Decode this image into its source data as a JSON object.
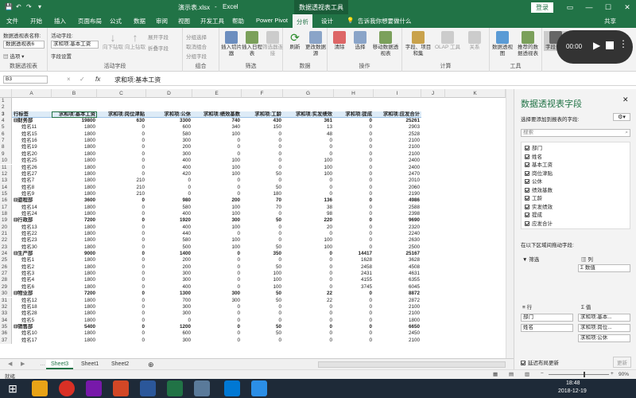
{
  "titlebar": {
    "filename": "演示表.xlsx",
    "sep": "-",
    "app": "Excel",
    "context_tab": "数据透视表工具",
    "login": "登录"
  },
  "tabs": [
    "文件",
    "开始",
    "插入",
    "页面布局",
    "公式",
    "数据",
    "审阅",
    "视图",
    "开发工具",
    "帮助",
    "Power Pivot",
    "分析",
    "设计"
  ],
  "tellme": "告诉我你想要做什么",
  "share": "共享",
  "ribbon": {
    "pivot_name_label": "数据透视表名称:",
    "pivot_name": "数据透视表6",
    "options": "选项",
    "active_field_label": "活动字段:",
    "active_field": "求和项:基本工资",
    "field_settings": "字段设置",
    "drill_down": "向下钻取",
    "drill_up": "向上钻取",
    "expand": "展开字段",
    "collapse": "折叠字段",
    "group_sel": "分组选择",
    "ungroup": "取消组合",
    "group_field": "分组字段",
    "group_label": "组合",
    "slicer": "插入切片器",
    "timeline": "插入日程表",
    "filter_conn": "筛选器连接",
    "filter_label": "筛选",
    "refresh": "刷新",
    "change_source": "更改数据源",
    "data_label": "数据",
    "clear": "清除",
    "select": "选择",
    "move": "移动数据透视表",
    "action_label": "操作",
    "fields_items": "字段、项目和集",
    "olap": "OLAP 工具",
    "relations": "关系",
    "calc_label": "计算",
    "pivotchart": "数据透视图",
    "recommended": "推荐的数据透视表",
    "tools_label": "工具",
    "field_list": "字段列表",
    "active_field_group": "活动字段",
    "pivot_group": "数据透视表"
  },
  "recorder": {
    "time": "00:00"
  },
  "formula": {
    "namebox": "B3",
    "cancel": "×",
    "enter": "✓",
    "fx": "fx",
    "content": "求和项:基本工资"
  },
  "columns": [
    "A",
    "B",
    "C",
    "D",
    "E",
    "F",
    "G",
    "H",
    "I",
    "J",
    "K"
  ],
  "rows": [
    {
      "n": "1",
      "cells": []
    },
    {
      "n": "2",
      "cells": []
    },
    {
      "n": "3",
      "hdr": true,
      "cells": [
        "行标签",
        "求和项:基本工资",
        "求和项:岗位津贴",
        "求和项:公休",
        "求和项:绩效基数",
        "求和项:工龄",
        "求和项:实发绩效",
        "求和项:提成",
        "求和项:应发合计"
      ]
    },
    {
      "n": "4",
      "grp": true,
      "cells": [
        "⊟财务部",
        "19800",
        "630",
        "3300",
        "740",
        "430",
        "361",
        "0",
        "25261"
      ]
    },
    {
      "n": "5",
      "cells": [
        "姓名11",
        "1800",
        "0",
        "600",
        "340",
        "150",
        "13",
        "0",
        "2903"
      ]
    },
    {
      "n": "6",
      "cells": [
        "姓名15",
        "1800",
        "0",
        "580",
        "100",
        "0",
        "48",
        "0",
        "2528"
      ]
    },
    {
      "n": "7",
      "cells": [
        "姓名16",
        "1800",
        "0",
        "300",
        "0",
        "0",
        "0",
        "0",
        "2100"
      ]
    },
    {
      "n": "8",
      "cells": [
        "姓名19",
        "1800",
        "0",
        "200",
        "0",
        "0",
        "0",
        "0",
        "2100"
      ]
    },
    {
      "n": "9",
      "cells": [
        "姓名20",
        "1800",
        "0",
        "300",
        "0",
        "0",
        "0",
        "0",
        "2100"
      ]
    },
    {
      "n": "10",
      "cells": [
        "姓名25",
        "1800",
        "0",
        "400",
        "100",
        "0",
        "100",
        "0",
        "2400"
      ]
    },
    {
      "n": "11",
      "cells": [
        "姓名26",
        "1800",
        "0",
        "400",
        "100",
        "0",
        "100",
        "0",
        "2400"
      ]
    },
    {
      "n": "12",
      "cells": [
        "姓名27",
        "1800",
        "0",
        "420",
        "100",
        "50",
        "100",
        "0",
        "2470"
      ]
    },
    {
      "n": "13",
      "cells": [
        "姓名7",
        "1800",
        "210",
        "0",
        "0",
        "0",
        "0",
        "0",
        "2010"
      ]
    },
    {
      "n": "14",
      "cells": [
        "姓名8",
        "1800",
        "210",
        "0",
        "0",
        "50",
        "0",
        "0",
        "2060"
      ]
    },
    {
      "n": "15",
      "cells": [
        "姓名9",
        "1800",
        "210",
        "0",
        "0",
        "180",
        "0",
        "0",
        "2190"
      ]
    },
    {
      "n": "16",
      "grp": true,
      "cells": [
        "⊟遊程部",
        "3600",
        "0",
        "980",
        "200",
        "70",
        "136",
        "0",
        "4986"
      ]
    },
    {
      "n": "17",
      "cells": [
        "姓名14",
        "1800",
        "0",
        "580",
        "100",
        "70",
        "38",
        "0",
        "2588"
      ]
    },
    {
      "n": "18",
      "cells": [
        "姓名24",
        "1800",
        "0",
        "400",
        "100",
        "0",
        "98",
        "0",
        "2398"
      ]
    },
    {
      "n": "19",
      "grp": true,
      "cells": [
        "⊟行政部",
        "7200",
        "0",
        "1920",
        "300",
        "50",
        "220",
        "0",
        "9690"
      ]
    },
    {
      "n": "20",
      "cells": [
        "姓名13",
        "1800",
        "0",
        "400",
        "100",
        "0",
        "20",
        "0",
        "2320"
      ]
    },
    {
      "n": "21",
      "cells": [
        "姓名22",
        "1800",
        "0",
        "440",
        "0",
        "0",
        "0",
        "0",
        "2240"
      ]
    },
    {
      "n": "22",
      "cells": [
        "姓名23",
        "1800",
        "0",
        "580",
        "100",
        "0",
        "100",
        "0",
        "2630"
      ]
    },
    {
      "n": "23",
      "cells": [
        "姓名30",
        "1800",
        "0",
        "500",
        "100",
        "50",
        "100",
        "0",
        "2500"
      ]
    },
    {
      "n": "24",
      "grp": true,
      "cells": [
        "⊟生产部",
        "9000",
        "0",
        "1400",
        "0",
        "350",
        "0",
        "14417",
        "25167"
      ]
    },
    {
      "n": "25",
      "cells": [
        "姓名1",
        "1800",
        "0",
        "200",
        "0",
        "0",
        "0",
        "1628",
        "3628"
      ]
    },
    {
      "n": "26",
      "cells": [
        "姓名2",
        "1800",
        "0",
        "200",
        "0",
        "50",
        "0",
        "2458",
        "4508"
      ]
    },
    {
      "n": "27",
      "cells": [
        "姓名3",
        "1800",
        "0",
        "300",
        "0",
        "100",
        "0",
        "2431",
        "4631"
      ]
    },
    {
      "n": "28",
      "cells": [
        "姓名4",
        "1800",
        "0",
        "300",
        "0",
        "100",
        "0",
        "4155",
        "6355"
      ]
    },
    {
      "n": "29",
      "cells": [
        "姓名6",
        "1800",
        "0",
        "400",
        "0",
        "100",
        "0",
        "3745",
        "6045"
      ]
    },
    {
      "n": "30",
      "grp": true,
      "cells": [
        "⊟物业部",
        "7200",
        "0",
        "1300",
        "300",
        "50",
        "22",
        "0",
        "8872"
      ]
    },
    {
      "n": "31",
      "cells": [
        "姓名12",
        "1800",
        "0",
        "700",
        "300",
        "50",
        "22",
        "0",
        "2872"
      ]
    },
    {
      "n": "32",
      "cells": [
        "姓名18",
        "1800",
        "0",
        "300",
        "0",
        "0",
        "0",
        "0",
        "2100"
      ]
    },
    {
      "n": "33",
      "cells": [
        "姓名28",
        "1800",
        "0",
        "300",
        "0",
        "0",
        "0",
        "0",
        "2100"
      ]
    },
    {
      "n": "34",
      "cells": [
        "姓名5",
        "1800",
        "0",
        "0",
        "0",
        "0",
        "0",
        "0",
        "1800"
      ]
    },
    {
      "n": "35",
      "grp": true,
      "cells": [
        "⊟销售部",
        "5400",
        "0",
        "1200",
        "0",
        "50",
        "0",
        "0",
        "6650"
      ]
    },
    {
      "n": "36",
      "cells": [
        "姓名10",
        "1800",
        "0",
        "600",
        "0",
        "50",
        "0",
        "0",
        "2450"
      ]
    },
    {
      "n": "37",
      "cells": [
        "姓名17",
        "1800",
        "0",
        "300",
        "0",
        "0",
        "0",
        "0",
        "2100"
      ]
    }
  ],
  "sheets": [
    "Sheet3",
    "Sheet1",
    "Sheet2"
  ],
  "status": {
    "ready": "就绪",
    "zoom": "90%"
  },
  "pane": {
    "title": "数据透视表字段",
    "subtitle": "选择要添加到报表的字段:",
    "search": "搜索",
    "fields": [
      "部门",
      "姓名",
      "基本工资",
      "岗位津贴",
      "公休",
      "绩效基数",
      "工龄",
      "实发绩效",
      "提成",
      "应发合计"
    ],
    "drag_hint": "在以下区域间拖动字段:",
    "filter": "筛选",
    "columns": "列",
    "columns_value": "Σ 数值",
    "rows": "行",
    "values": "值",
    "row1": "部门",
    "row2": "姓名",
    "val1": "求和项:基本...",
    "val2": "求和项:岗位...",
    "val3": "求和项:公休",
    "defer": "延迟布局更新",
    "update": "更新"
  },
  "taskbar": {
    "time": "18:48",
    "date": "2018-12-19"
  }
}
